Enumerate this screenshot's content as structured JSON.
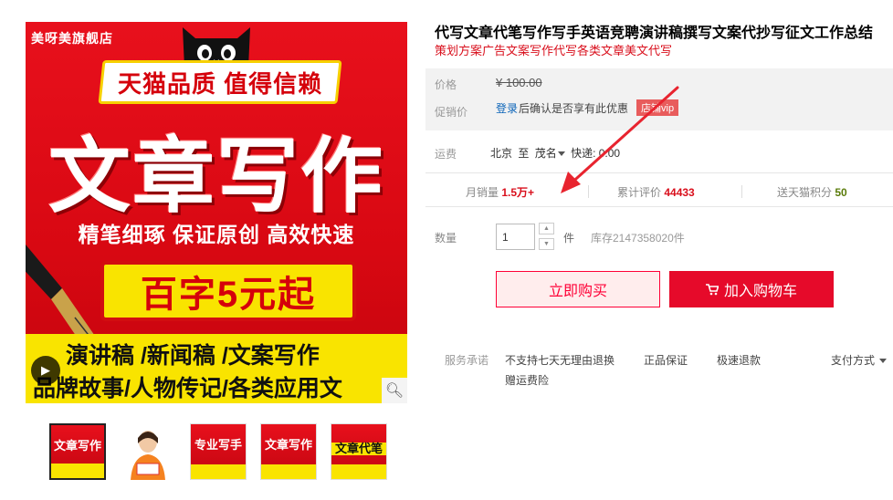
{
  "gallery": {
    "shop_tag": "美呀美旗舰店",
    "banner": "天猫品质 值得信赖",
    "headline": "文章写作",
    "slogan": "精笔细琢  保证原创  高效快速",
    "price_line": "百字5元起",
    "line1": "演讲稿 /新闻稿 /文案写作",
    "line2": "品牌故事/人物传记/各类应用文",
    "thumbnails": [
      {
        "label": "文章写作"
      },
      {
        "label": ""
      },
      {
        "label": "专业写手"
      },
      {
        "label": "文章写作"
      },
      {
        "label": "文章代笔"
      }
    ]
  },
  "product": {
    "title": "代写文章代笔写作写手英语竞聘演讲稿撰写文案代抄写征文工作总结",
    "subtitle": "策划方案广告文案写作代写各类文章美文代写"
  },
  "price": {
    "label": "价格",
    "original": "¥ 100.00",
    "promo_label": "促销价",
    "login_link": "登录",
    "login_tail": "后确认是否享有此优惠",
    "vip_badge": "店铺vip"
  },
  "shipping": {
    "label": "运费",
    "from": "北京",
    "to_word": "至",
    "to": "茂名",
    "fee": "快递: 0.00"
  },
  "stats": {
    "monthly_label": "月销量",
    "monthly_value": "1.5万+",
    "reviews_label": "累计评价",
    "reviews_value": "44433",
    "points_label": "送天猫积分",
    "points_value": "50"
  },
  "quantity": {
    "label": "数量",
    "value": "1",
    "unit": "件",
    "stock": "库存2147358020件"
  },
  "actions": {
    "buy_now": "立即购买",
    "add_cart": "加入购物车"
  },
  "service": {
    "label": "服务承诺",
    "items": [
      "不支持七天无理由退换",
      "正品保证",
      "极速退款",
      "赠运费险"
    ],
    "payment": "支付方式"
  },
  "colors": {
    "accent": "#e60a2a",
    "link": "#0a63b8",
    "banner_yellow": "#f9e400"
  }
}
